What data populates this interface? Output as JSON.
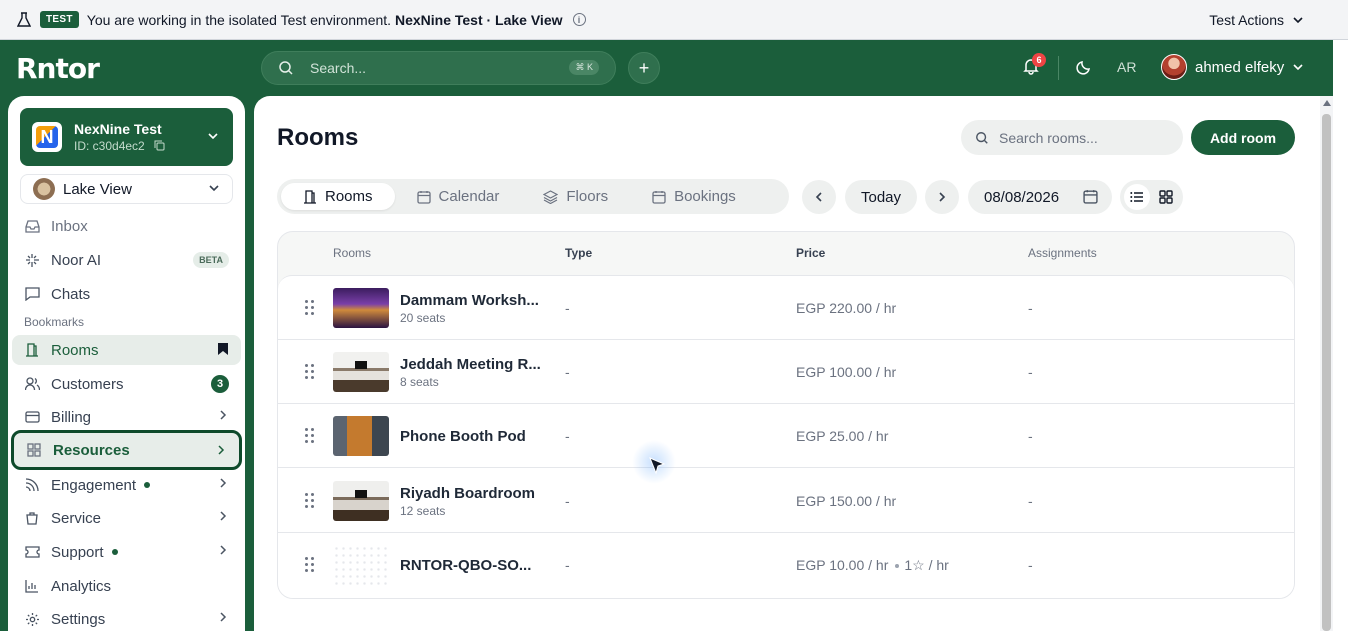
{
  "banner": {
    "tag": "TEST",
    "message_prefix": "You are working in the isolated Test environment.",
    "environment_name": "NexNine Test · Lake View",
    "actions_label": "Test Actions",
    "icon": "flask-icon"
  },
  "header": {
    "logo": "Rntor",
    "search_placeholder": "Search...",
    "search_shortcut": "⌘ K",
    "notifications_count": "6",
    "language": "AR",
    "user_name": "ahmed elfeky"
  },
  "sidebar": {
    "org": {
      "name": "NexNine Test",
      "id": "ID: c30d4ec2",
      "logo_letter": "N"
    },
    "location": "Lake View",
    "bookmarks_label": "Bookmarks",
    "items": [
      {
        "label": "Inbox",
        "icon": "inbox-icon"
      },
      {
        "label": "Noor AI",
        "icon": "sparkle-icon",
        "badge": "BETA"
      },
      {
        "label": "Chats",
        "icon": "chat-icon"
      },
      {
        "label": "Rooms",
        "icon": "door-icon"
      },
      {
        "label": "Customers",
        "icon": "users-icon",
        "badge": "3"
      },
      {
        "label": "Billing",
        "icon": "card-icon"
      },
      {
        "label": "Resources",
        "icon": "grid-icon"
      },
      {
        "label": "Engagement",
        "icon": "rss-icon"
      },
      {
        "label": "Service",
        "icon": "bag-icon"
      },
      {
        "label": "Support",
        "icon": "ticket-icon"
      },
      {
        "label": "Analytics",
        "icon": "bar-chart-icon"
      },
      {
        "label": "Settings",
        "icon": "gear-icon"
      }
    ]
  },
  "main": {
    "title": "Rooms",
    "search_placeholder": "Search rooms...",
    "add_button": "Add room",
    "tabs": [
      "Rooms",
      "Calendar",
      "Floors",
      "Bookings"
    ],
    "today_label": "Today",
    "date_value": "08/08/2026",
    "columns": [
      "Rooms",
      "Type",
      "Price",
      "Assignments"
    ],
    "rows": [
      {
        "name": "Dammam Worksh...",
        "seats": "20 seats",
        "type": "-",
        "price": "EGP 220.00 / hr",
        "assignments": "-"
      },
      {
        "name": "Jeddah Meeting R...",
        "seats": "8 seats",
        "type": "-",
        "price": "EGP 100.00 / hr",
        "assignments": "-"
      },
      {
        "name": "Phone Booth Pod",
        "seats": "",
        "type": "-",
        "price": "EGP 25.00 / hr",
        "assignments": "-"
      },
      {
        "name": "Riyadh Boardroom",
        "seats": "12 seats",
        "type": "-",
        "price": "EGP 150.00 / hr",
        "assignments": "-"
      },
      {
        "name": "RNTOR-QBO-SO...",
        "seats": "",
        "type": "-",
        "price": "EGP 10.00 / hr",
        "price_extra": "1☆ / hr",
        "assignments": "-"
      }
    ]
  }
}
